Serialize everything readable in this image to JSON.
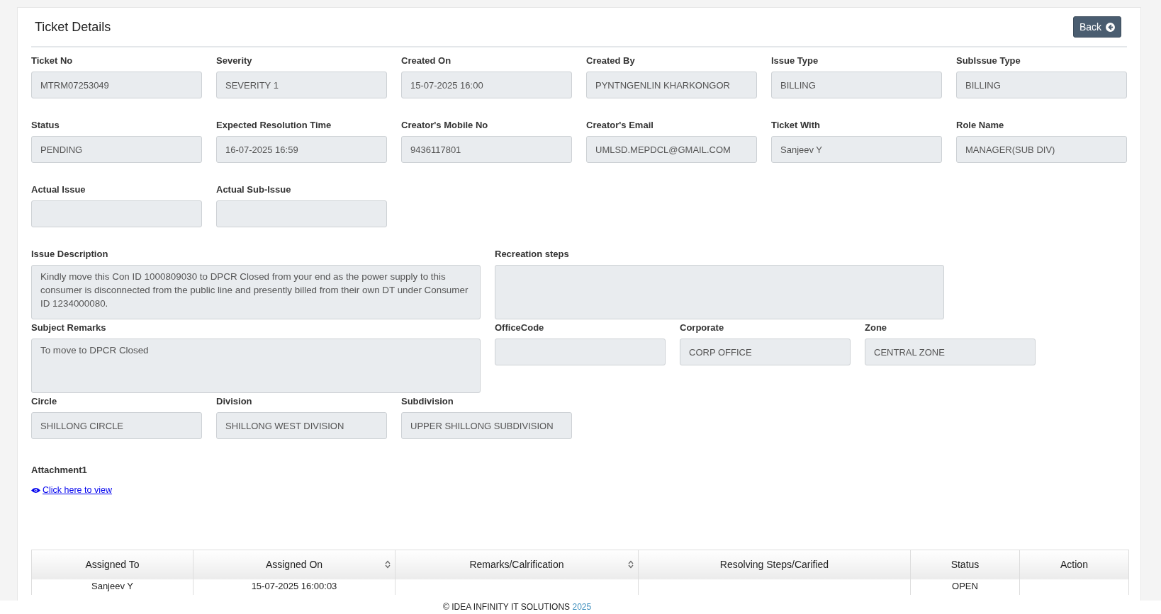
{
  "header": {
    "title": "Ticket Details",
    "back_button": "Back"
  },
  "field_rows": [
    [
      {
        "label": "Ticket No",
        "value": "MTRM07253049"
      },
      {
        "label": "Severity",
        "value": "SEVERITY 1"
      },
      {
        "label": "Created On",
        "value": "15-07-2025 16:00"
      },
      {
        "label": "Created By",
        "value": "PYNTNGENLIN KHARKONGOR"
      },
      {
        "label": "Issue Type",
        "value": "BILLING"
      },
      {
        "label": "SubIssue Type",
        "value": "BILLING"
      }
    ],
    [
      {
        "label": "Status",
        "value": "PENDING"
      },
      {
        "label": "Expected Resolution Time",
        "value": "16-07-2025 16:59"
      },
      {
        "label": "Creator's Mobile No",
        "value": "9436117801"
      },
      {
        "label": "Creator's Email",
        "value": "UMLSD.MEPDCL@GMAIL.COM"
      },
      {
        "label": "Ticket With",
        "value": "Sanjeev Y"
      },
      {
        "label": "Role Name",
        "value": "MANAGER(SUB DIV)"
      }
    ],
    [
      {
        "label": "Actual Issue"
      },
      {
        "label": "Actual Sub-Issue"
      }
    ]
  ],
  "description_row": [
    {
      "kind": "area",
      "label": "Issue Description",
      "value": "Kindly move this Con ID 1000809030 to DPCR Closed from your end as the power supply to this consumer is disconnected from the public line and presently billed from their own DT under Consumer  ID 1234000080."
    },
    {
      "kind": "area",
      "label": "Recreation steps"
    }
  ],
  "remarks_row": [
    {
      "kind": "area",
      "label": "Subject Remarks",
      "value": "To move to DPCR Closed"
    },
    {
      "kind": "input",
      "label": "OfficeCode"
    },
    {
      "kind": "input",
      "label": "Corporate",
      "value": "CORP OFFICE"
    },
    {
      "kind": "input",
      "label": "Zone",
      "value": "CENTRAL ZONE"
    }
  ],
  "location_row": [
    {
      "label": "Circle",
      "value": "SHILLONG CIRCLE"
    },
    {
      "label": "Division",
      "value": "SHILLONG WEST DIVISION"
    },
    {
      "label": "Subdivision",
      "value": "UPPER SHILLONG SUBDIVISION"
    }
  ],
  "attachment": {
    "label": "Attachment1",
    "link": "Click here to view"
  },
  "table": {
    "columns": [
      {
        "label": "Assigned To",
        "sortable": false
      },
      {
        "label": "Assigned On",
        "sortable": true
      },
      {
        "label": "Remarks/Calrification",
        "sortable": true
      },
      {
        "label": "Resolving Steps/Carified",
        "sortable": false
      },
      {
        "label": "Status",
        "sortable": false
      },
      {
        "label": "Action",
        "sortable": false
      }
    ],
    "rows": [
      [
        "Sanjeev Y",
        "15-07-2025 16:00:03",
        "",
        "",
        "OPEN",
        ""
      ]
    ]
  },
  "footer": {
    "text": "© IDEA INFINITY IT SOLUTIONS",
    "year": "2025"
  }
}
